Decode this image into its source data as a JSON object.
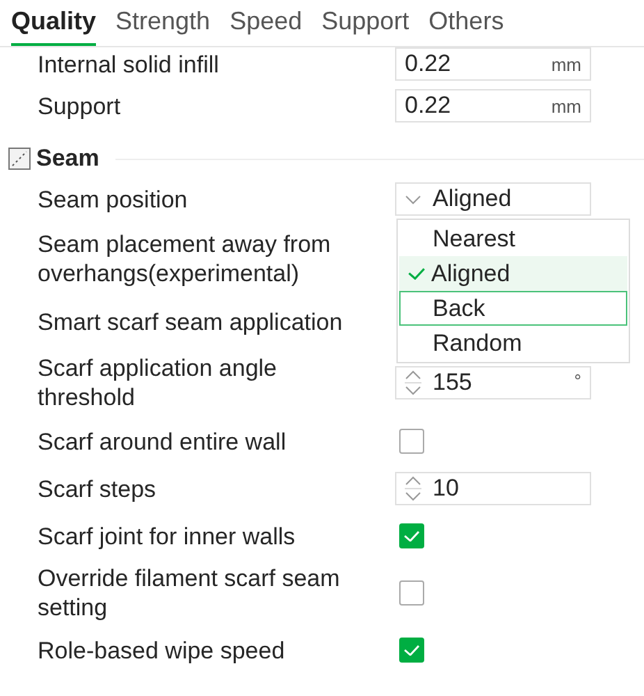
{
  "tabs": [
    {
      "label": "Quality",
      "selected": true
    },
    {
      "label": "Strength",
      "selected": false
    },
    {
      "label": "Speed",
      "selected": false
    },
    {
      "label": "Support",
      "selected": false
    },
    {
      "label": "Others",
      "selected": false
    }
  ],
  "top_rows": [
    {
      "label": "Internal solid infill",
      "kind": "number",
      "value": "0.22",
      "unit": "mm"
    },
    {
      "label": "Support",
      "kind": "number",
      "value": "0.22",
      "unit": "mm"
    }
  ],
  "section": {
    "title": "Seam"
  },
  "rows": [
    {
      "label": "Seam position",
      "kind": "select",
      "value": "Aligned"
    },
    {
      "label": "Seam placement away from overhangs(experimental)",
      "kind": "hidden"
    },
    {
      "label": "Smart scarf seam application",
      "kind": "hidden"
    },
    {
      "label": "Scarf application angle threshold",
      "kind": "spin",
      "value": "155",
      "unit": "°"
    },
    {
      "label": "Scarf around entire wall",
      "kind": "checkbox",
      "checked": false
    },
    {
      "label": "Scarf steps",
      "kind": "spin",
      "value": "10"
    },
    {
      "label": "Scarf joint for inner walls",
      "kind": "checkbox",
      "checked": true
    },
    {
      "label": "Override filament scarf seam setting",
      "kind": "checkbox",
      "checked": false
    },
    {
      "label": "Role-based wipe speed",
      "kind": "checkbox",
      "checked": true
    }
  ],
  "dropdown": {
    "options": [
      {
        "label": "Nearest",
        "selected": false,
        "hovered": false
      },
      {
        "label": "Aligned",
        "selected": true,
        "hovered": false
      },
      {
        "label": "Back",
        "selected": false,
        "hovered": true
      },
      {
        "label": "Random",
        "selected": false,
        "hovered": false
      }
    ]
  }
}
